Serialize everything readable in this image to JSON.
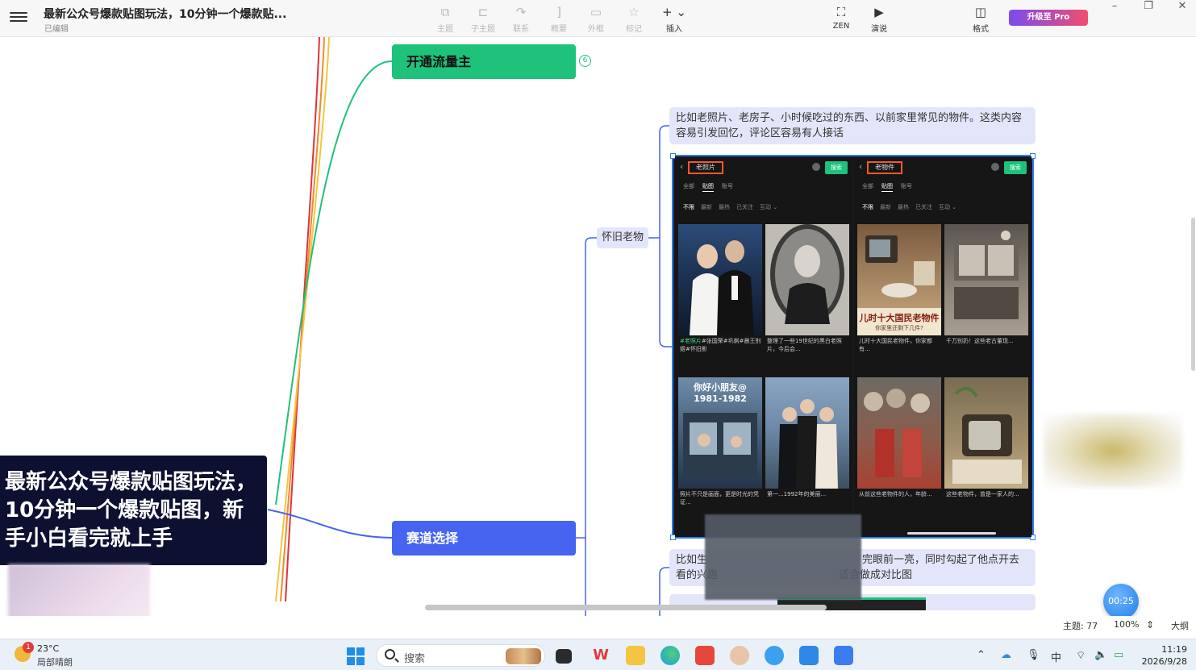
{
  "window": {
    "title": "最新公众号爆款贴图玩法，10分钟一个爆款贴...",
    "status": "已编辑",
    "minimize": "–",
    "maximize": "❐",
    "close": "✕"
  },
  "toolbar": {
    "tools": [
      {
        "name": "topic",
        "icon": "⧉",
        "label": "主题"
      },
      {
        "name": "subtopic",
        "icon": "⊏",
        "label": "子主题"
      },
      {
        "name": "relation",
        "icon": "↷",
        "label": "联系"
      },
      {
        "name": "summary",
        "icon": "]",
        "label": "概要"
      },
      {
        "name": "boundary",
        "icon": "▭",
        "label": "外框"
      },
      {
        "name": "marker",
        "icon": "☆",
        "label": "标记"
      },
      {
        "name": "insert",
        "icon": "+ ⌄",
        "label": "插入"
      }
    ],
    "zen": {
      "icon": "⛶",
      "label": "ZEN"
    },
    "present": {
      "icon": "▶",
      "label": "演说"
    },
    "format": {
      "icon": "◫",
      "label": "格式"
    },
    "upgrade": "升级至 Pro"
  },
  "canvas": {
    "node_green": "开通流量主",
    "node_green_badge": "6",
    "node_blue": "赛道选择",
    "node_sub": "怀旧老物",
    "note1": "比如老照片、老房子、小时候吃过的东西、以前家里常见的物件。这类内容容易引发回忆，评论区容易有人接话",
    "note2_line1_a": "比如生",
    "note2_line1_b": "完眼前一亮，同时勾起了他点开去",
    "note2_line2_a": "看的兴趣",
    "note2_line2_b": "适合做成对比图",
    "overlay_title": "最新公众号爆款贴图玩法，10分钟一个爆款贴图，新手小白看完就上手",
    "timer": "00:25"
  },
  "image_block": {
    "left_panel": {
      "search": "老照片",
      "go": "搜索",
      "tabs": [
        "全部",
        "贴图",
        "账号"
      ],
      "filters": [
        "不限",
        "最新",
        "最热",
        "已关注",
        "互动 ⌄"
      ],
      "captions": [
        {
          "hl": "#老照片",
          "text": "#张国荣#巩俐#晨王别姬#怀旧影"
        },
        {
          "hl": "",
          "text": "整理了一些19世纪的黑白老照片，今后会..."
        },
        {
          "hl": "",
          "text": "照片不只是画面，更是时光的凭证..."
        },
        {
          "hl": "",
          "text": "第一...1992年的美丽..."
        }
      ],
      "thumb_titles": [
        "",
        "",
        "你好小朋友@ 1981-1982",
        ""
      ]
    },
    "right_panel": {
      "search": "老物件",
      "go": "搜索",
      "tabs": [
        "全部",
        "贴图",
        "账号"
      ],
      "filters": [
        "不限",
        "最新",
        "最热",
        "已关注",
        "互动 ⌄"
      ],
      "captions": [
        {
          "hl": "",
          "text": "儿时十大国民老物件，你家都有..."
        },
        {
          "hl": "",
          "text": "千万别扔！这些老古董现..."
        },
        {
          "hl": "",
          "text": "从前这些老物件的人，年龄..."
        },
        {
          "hl": "",
          "text": "这些老物件，曾是一家人的..."
        }
      ],
      "thumb_titles": [
        "儿时十大国民老物件",
        "",
        "",
        ""
      ],
      "thumb_subtitle": "你家里还剩下几件?"
    }
  },
  "statusbar": {
    "topics": "主题: 77",
    "zoom": "100%",
    "outline": "大纲"
  },
  "taskbar": {
    "weather_badge": "1",
    "temp": "23°C",
    "weather": "局部晴朗",
    "search": "搜索",
    "ime": "中",
    "time": "11:19",
    "date": "2026/9/28",
    "colors": {
      "start": "#1f8fe8",
      "wps": "#e23b3b",
      "folder": "#f4c542",
      "edge": "#1d9be0"
    }
  },
  "colors": {
    "green_node": "#1ec27b",
    "blue_node": "#4664f0",
    "note_bg": "#e3e6fb",
    "selection": "#2d7bf4",
    "overlay": "#0d1030"
  }
}
